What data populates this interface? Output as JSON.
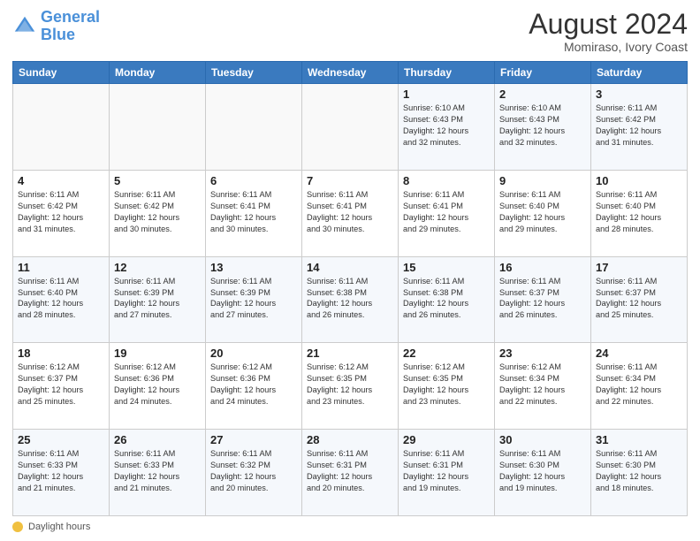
{
  "header": {
    "logo_line1": "General",
    "logo_line2": "Blue",
    "month_year": "August 2024",
    "location": "Momiraso, Ivory Coast"
  },
  "days_of_week": [
    "Sunday",
    "Monday",
    "Tuesday",
    "Wednesday",
    "Thursday",
    "Friday",
    "Saturday"
  ],
  "legend_text": "Daylight hours",
  "weeks": [
    [
      {
        "day": "",
        "info": ""
      },
      {
        "day": "",
        "info": ""
      },
      {
        "day": "",
        "info": ""
      },
      {
        "day": "",
        "info": ""
      },
      {
        "day": "1",
        "info": "Sunrise: 6:10 AM\nSunset: 6:43 PM\nDaylight: 12 hours\nand 32 minutes."
      },
      {
        "day": "2",
        "info": "Sunrise: 6:10 AM\nSunset: 6:43 PM\nDaylight: 12 hours\nand 32 minutes."
      },
      {
        "day": "3",
        "info": "Sunrise: 6:11 AM\nSunset: 6:42 PM\nDaylight: 12 hours\nand 31 minutes."
      }
    ],
    [
      {
        "day": "4",
        "info": "Sunrise: 6:11 AM\nSunset: 6:42 PM\nDaylight: 12 hours\nand 31 minutes."
      },
      {
        "day": "5",
        "info": "Sunrise: 6:11 AM\nSunset: 6:42 PM\nDaylight: 12 hours\nand 30 minutes."
      },
      {
        "day": "6",
        "info": "Sunrise: 6:11 AM\nSunset: 6:41 PM\nDaylight: 12 hours\nand 30 minutes."
      },
      {
        "day": "7",
        "info": "Sunrise: 6:11 AM\nSunset: 6:41 PM\nDaylight: 12 hours\nand 30 minutes."
      },
      {
        "day": "8",
        "info": "Sunrise: 6:11 AM\nSunset: 6:41 PM\nDaylight: 12 hours\nand 29 minutes."
      },
      {
        "day": "9",
        "info": "Sunrise: 6:11 AM\nSunset: 6:40 PM\nDaylight: 12 hours\nand 29 minutes."
      },
      {
        "day": "10",
        "info": "Sunrise: 6:11 AM\nSunset: 6:40 PM\nDaylight: 12 hours\nand 28 minutes."
      }
    ],
    [
      {
        "day": "11",
        "info": "Sunrise: 6:11 AM\nSunset: 6:40 PM\nDaylight: 12 hours\nand 28 minutes."
      },
      {
        "day": "12",
        "info": "Sunrise: 6:11 AM\nSunset: 6:39 PM\nDaylight: 12 hours\nand 27 minutes."
      },
      {
        "day": "13",
        "info": "Sunrise: 6:11 AM\nSunset: 6:39 PM\nDaylight: 12 hours\nand 27 minutes."
      },
      {
        "day": "14",
        "info": "Sunrise: 6:11 AM\nSunset: 6:38 PM\nDaylight: 12 hours\nand 26 minutes."
      },
      {
        "day": "15",
        "info": "Sunrise: 6:11 AM\nSunset: 6:38 PM\nDaylight: 12 hours\nand 26 minutes."
      },
      {
        "day": "16",
        "info": "Sunrise: 6:11 AM\nSunset: 6:37 PM\nDaylight: 12 hours\nand 26 minutes."
      },
      {
        "day": "17",
        "info": "Sunrise: 6:11 AM\nSunset: 6:37 PM\nDaylight: 12 hours\nand 25 minutes."
      }
    ],
    [
      {
        "day": "18",
        "info": "Sunrise: 6:12 AM\nSunset: 6:37 PM\nDaylight: 12 hours\nand 25 minutes."
      },
      {
        "day": "19",
        "info": "Sunrise: 6:12 AM\nSunset: 6:36 PM\nDaylight: 12 hours\nand 24 minutes."
      },
      {
        "day": "20",
        "info": "Sunrise: 6:12 AM\nSunset: 6:36 PM\nDaylight: 12 hours\nand 24 minutes."
      },
      {
        "day": "21",
        "info": "Sunrise: 6:12 AM\nSunset: 6:35 PM\nDaylight: 12 hours\nand 23 minutes."
      },
      {
        "day": "22",
        "info": "Sunrise: 6:12 AM\nSunset: 6:35 PM\nDaylight: 12 hours\nand 23 minutes."
      },
      {
        "day": "23",
        "info": "Sunrise: 6:12 AM\nSunset: 6:34 PM\nDaylight: 12 hours\nand 22 minutes."
      },
      {
        "day": "24",
        "info": "Sunrise: 6:11 AM\nSunset: 6:34 PM\nDaylight: 12 hours\nand 22 minutes."
      }
    ],
    [
      {
        "day": "25",
        "info": "Sunrise: 6:11 AM\nSunset: 6:33 PM\nDaylight: 12 hours\nand 21 minutes."
      },
      {
        "day": "26",
        "info": "Sunrise: 6:11 AM\nSunset: 6:33 PM\nDaylight: 12 hours\nand 21 minutes."
      },
      {
        "day": "27",
        "info": "Sunrise: 6:11 AM\nSunset: 6:32 PM\nDaylight: 12 hours\nand 20 minutes."
      },
      {
        "day": "28",
        "info": "Sunrise: 6:11 AM\nSunset: 6:31 PM\nDaylight: 12 hours\nand 20 minutes."
      },
      {
        "day": "29",
        "info": "Sunrise: 6:11 AM\nSunset: 6:31 PM\nDaylight: 12 hours\nand 19 minutes."
      },
      {
        "day": "30",
        "info": "Sunrise: 6:11 AM\nSunset: 6:30 PM\nDaylight: 12 hours\nand 19 minutes."
      },
      {
        "day": "31",
        "info": "Sunrise: 6:11 AM\nSunset: 6:30 PM\nDaylight: 12 hours\nand 18 minutes."
      }
    ]
  ]
}
